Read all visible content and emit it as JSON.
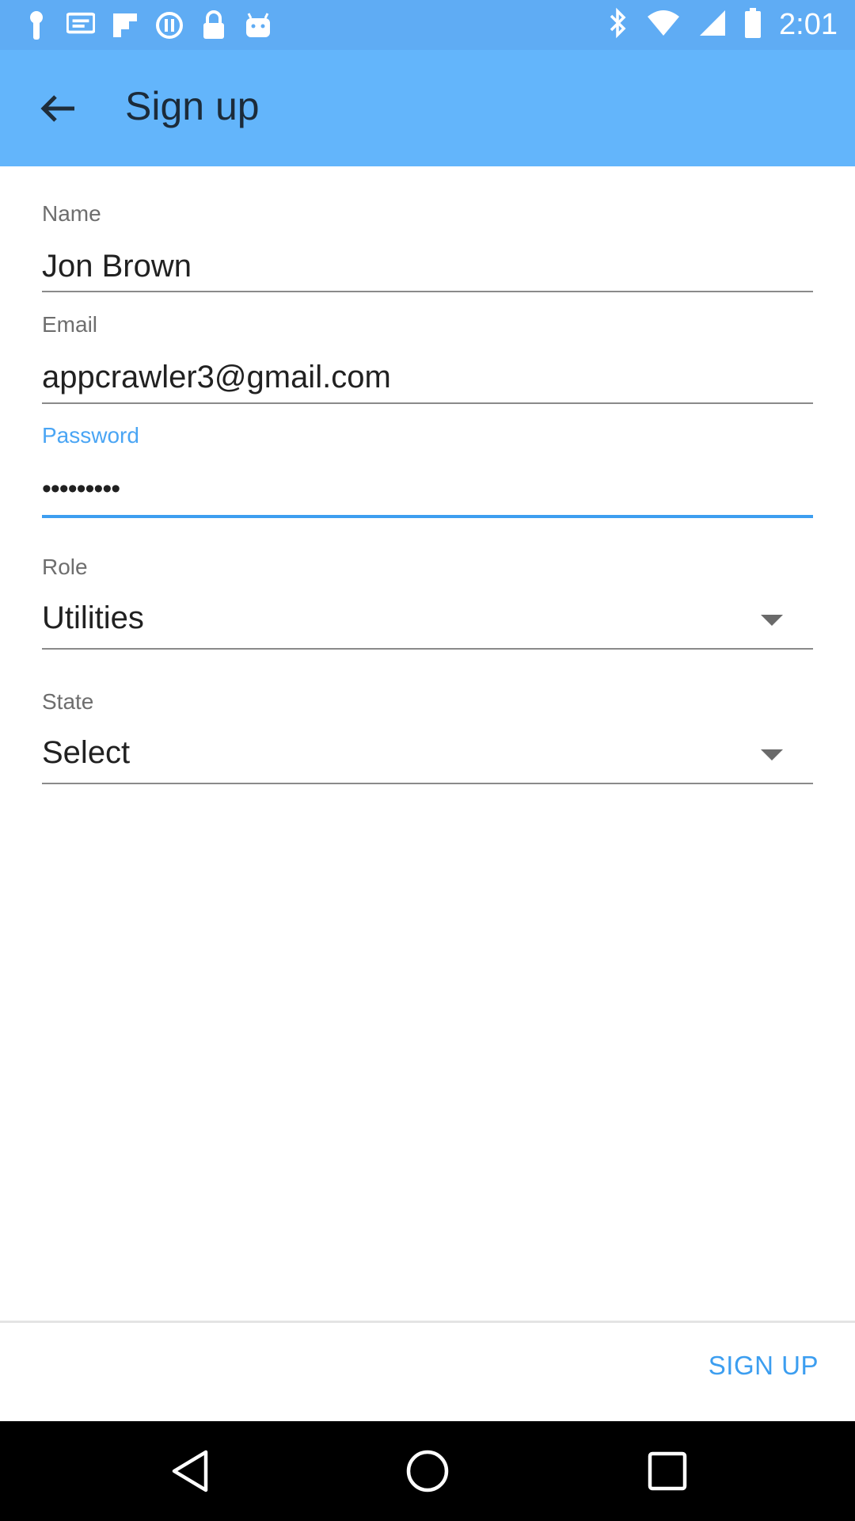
{
  "status_bar": {
    "time": "2:01",
    "icons": [
      "notification-pin-icon",
      "message-icon",
      "flipboard-icon",
      "info-circle-icon",
      "lock-icon",
      "android-icon",
      "bluetooth-icon",
      "wifi-icon",
      "signal-icon",
      "battery-icon"
    ]
  },
  "app_bar": {
    "title": "Sign up",
    "back_icon": "arrow-back-icon"
  },
  "form": {
    "name": {
      "label": "Name",
      "value": "Jon Brown"
    },
    "email": {
      "label": "Email",
      "value": "appcrawler3@gmail.com"
    },
    "password": {
      "label": "Password",
      "value": "•••••••••"
    },
    "role": {
      "label": "Role",
      "value": "Utilities"
    },
    "state": {
      "label": "State",
      "value": "Select"
    }
  },
  "actions": {
    "signup_label": "SIGN UP"
  },
  "colors": {
    "status_bar": "#5facf4",
    "app_bar": "#63b5fb",
    "accent": "#3d9ef0"
  },
  "nav": {
    "icons": [
      "back-triangle-icon",
      "home-circle-icon",
      "recents-square-icon"
    ]
  }
}
